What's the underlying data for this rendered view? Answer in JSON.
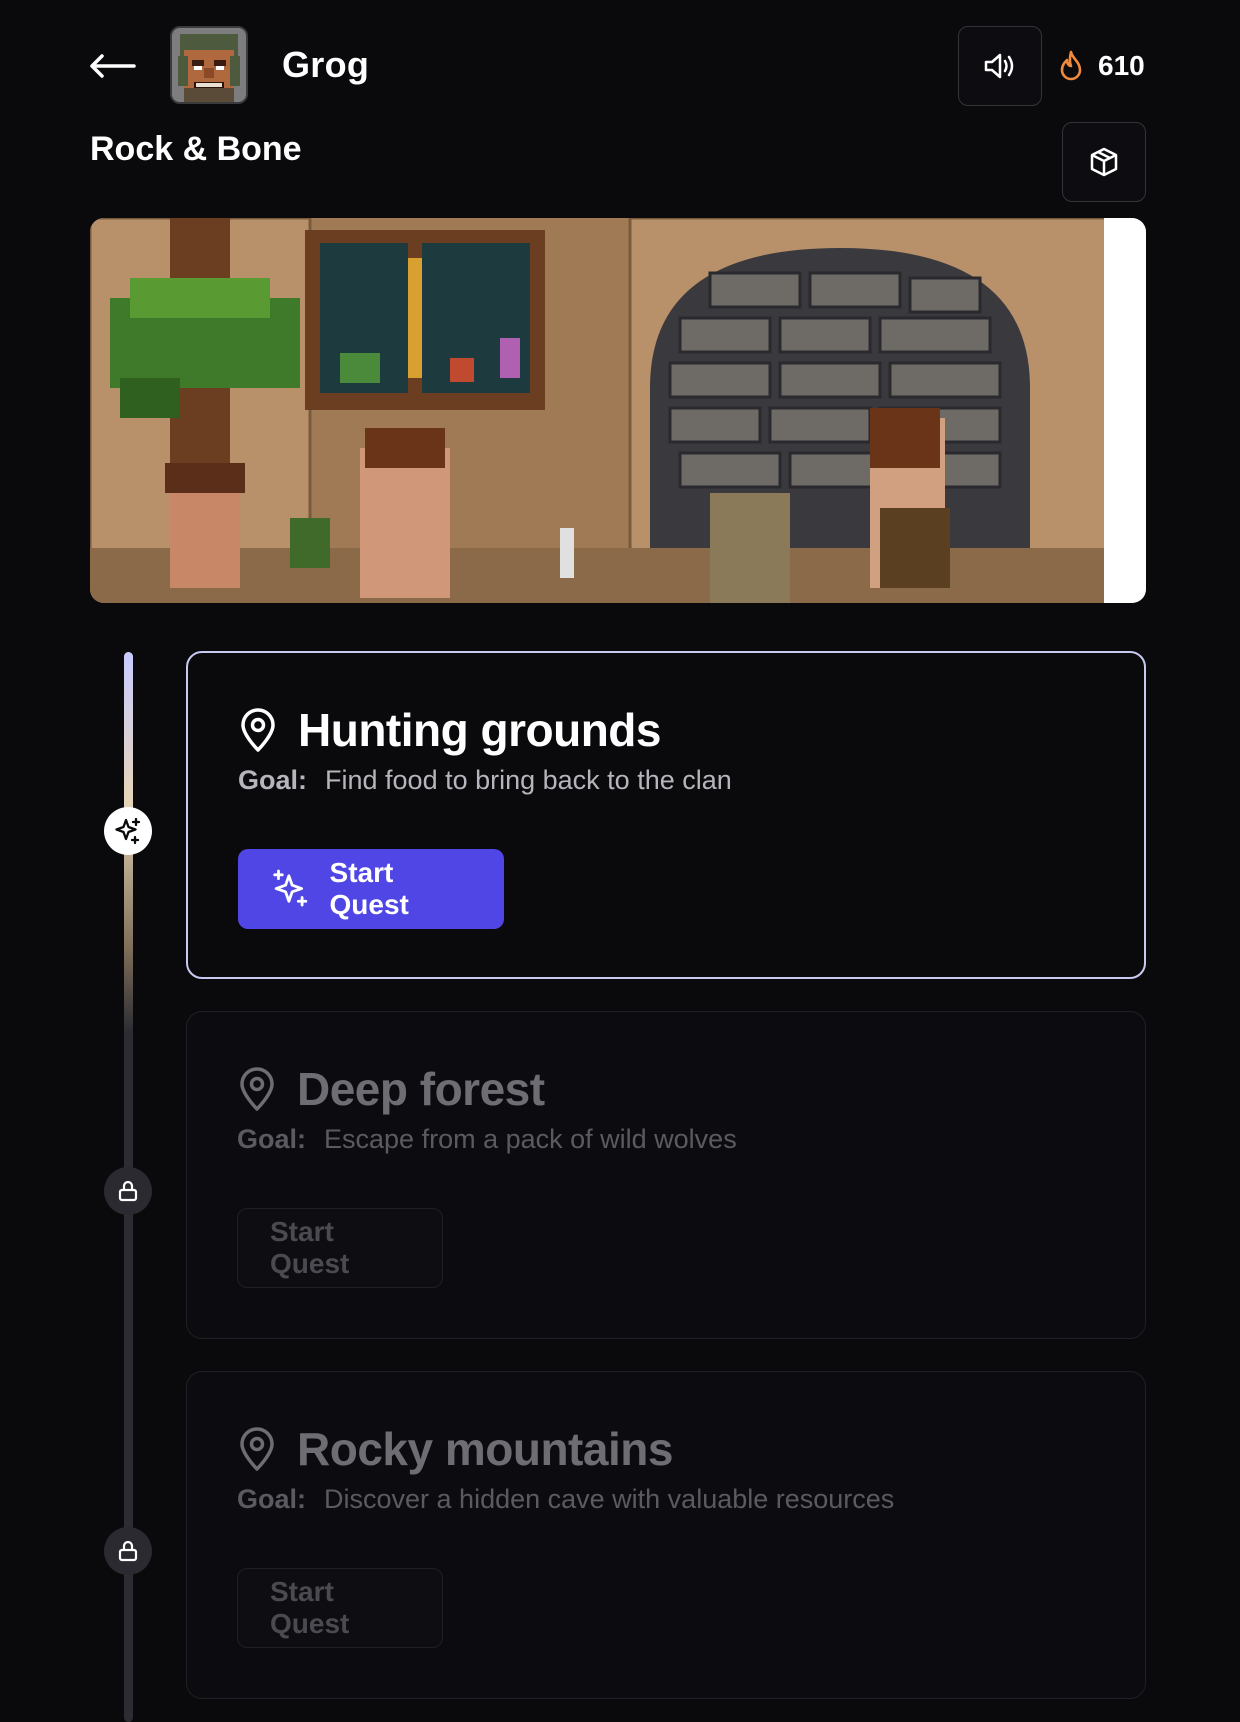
{
  "header": {
    "character_name": "Grog",
    "streak_count": "610"
  },
  "world": {
    "title": "Rock & Bone"
  },
  "quests": [
    {
      "title": "Hunting grounds",
      "goal_label": "Goal:",
      "goal_text": "Find food to bring back to the clan",
      "button_label": "Start Quest",
      "state": "active"
    },
    {
      "title": "Deep forest",
      "goal_label": "Goal:",
      "goal_text": "Escape from a pack of wild wolves",
      "button_label": "Start Quest",
      "state": "locked"
    },
    {
      "title": "Rocky mountains",
      "goal_label": "Goal:",
      "goal_text": "Discover a hidden cave with valuable resources",
      "button_label": "Start Quest",
      "state": "locked"
    }
  ],
  "colors": {
    "background": "#0a0a0d",
    "accent": "#4f46e5",
    "streak_flame": "#f08a3c",
    "active_border": "#c7c9ef"
  },
  "icons": {
    "back": "arrow-left-icon",
    "sound": "speaker-icon",
    "streak": "flame-icon",
    "inventory": "box-icon",
    "location": "map-pin-icon",
    "quest": "sparkles-icon",
    "locked": "lock-icon"
  }
}
